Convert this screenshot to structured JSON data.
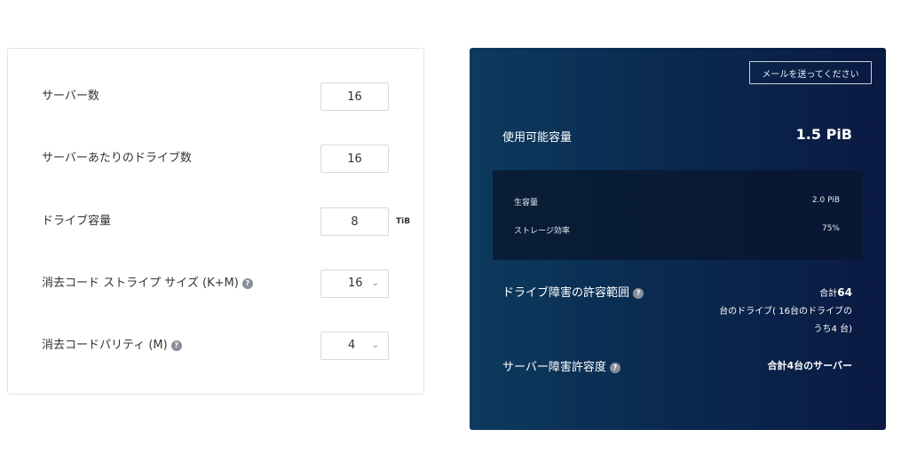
{
  "form": {
    "servers": {
      "label": "サーバー数",
      "value": "16"
    },
    "drives_per_server": {
      "label": "サーバーあたりのドライブ数",
      "value": "16"
    },
    "drive_capacity": {
      "label": "ドライブ容量",
      "value": "8",
      "unit": "TiB"
    },
    "stripe_size": {
      "label": "消去コード ストライプ サイズ (K+M)",
      "value": "16"
    },
    "parity": {
      "label": "消去コードパリティ (M)",
      "value": "4"
    },
    "help_glyph": "?"
  },
  "results": {
    "email_button": "メールを送ってください",
    "usable_capacity": {
      "label": "使用可能容量",
      "value": "1.5 PiB"
    },
    "raw_capacity": {
      "label": "生容量",
      "value": "2.0 PiB"
    },
    "storage_efficiency": {
      "label": "ストレージ効率",
      "value": "75%"
    },
    "drive_failure": {
      "label": "ドライブ障害の許容範囲",
      "prefix": "合計",
      "count": "64",
      "line2": "台のドライブ( 16台のドライブの",
      "line3": "うち4 台)"
    },
    "server_failure": {
      "label": "サーバー障害許容度",
      "prefix": "合計",
      "value": "4台のサーバー"
    }
  },
  "colors": {
    "panel_gradient_start": "#0d3a5e",
    "panel_gradient_end": "#0a1a42",
    "help_icon": "#8a8f99"
  },
  "icons": {
    "help": "question-circle-icon",
    "dropdown": "chevron-down-icon"
  }
}
